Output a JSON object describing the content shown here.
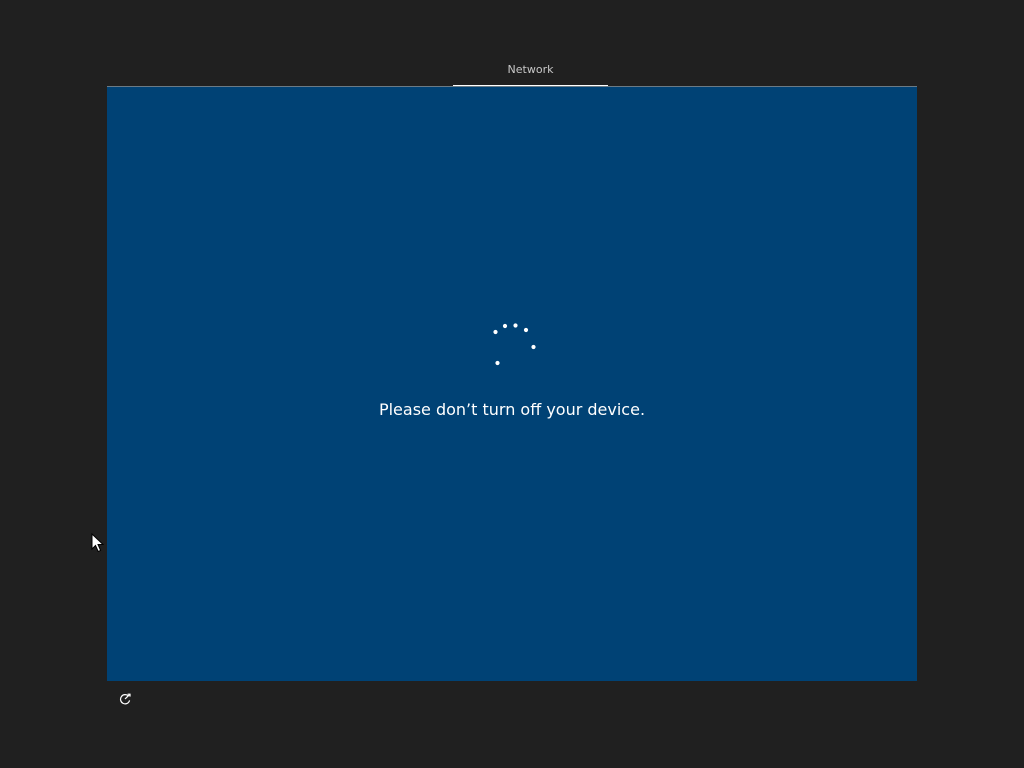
{
  "progress": {
    "current_step": "Network"
  },
  "main": {
    "message": "Please don’t turn off your device."
  },
  "icons": {
    "spinner": "loading-spinner-icon",
    "accessibility": "ease-of-access-icon",
    "cursor": "mouse-pointer-icon"
  },
  "colors": {
    "background": "#202020",
    "panel": "#004275",
    "text": "#ffffff"
  }
}
